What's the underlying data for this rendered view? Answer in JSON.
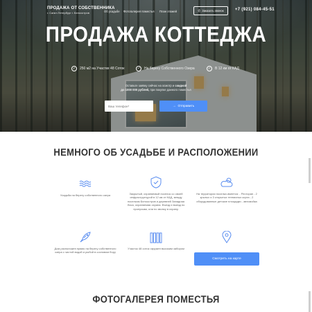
{
  "header": {
    "logo_title": "ПРОДАЖА ОТ СОБСТВЕННИКА",
    "logo_subtitle": "г. Санкт-Петербург г. Белоостров",
    "nav": [
      "Об усадьбе",
      "Фотогалерея поместья",
      "План этажей"
    ],
    "callback_label": "Заказать звонок",
    "phone": "+7 (921) 084-45-51"
  },
  "hero": {
    "title": "ПРОДАЖА КОТТЕДЖА",
    "features": [
      "250 м2 на Участке 48 Соток",
      "На берегу Собственного Озера",
      "В 12 км от КАД"
    ],
    "offer_line1": "Оставьте заявку сейчас на осмотр и",
    "offer_bold1": "скидкой",
    "offer_line2_bold": "до 1000 000 рублей,",
    "offer_line2": "при покупке данного поместья",
    "phone_placeholder": "Ваш телефон*",
    "send_label": "Отправить"
  },
  "about": {
    "title": "НЕМНОГО ОБ УСАДЬБЕ И РАСПОЛОЖЕНИИ",
    "cards": [
      {
        "icon": "waves-icon",
        "text": "Усадьба на берегу собственного озера"
      },
      {
        "icon": "shield-icon",
        "text": "Закрытый, охраняемый поселок со своей инфраструктурой в 12 км от КАД, между поселком Белоостров и деревней Западная Лиса, охраняемая охрана. Въезд и выезд по пропускам, или по звонку в охрану."
      },
      {
        "icon": "cloud-sun-icon",
        "text": "На территории поселка имеется: - Ресторан - 2 крытых и 3 открытых теннисных корта - 2 оборудованные детские площадки - автомойка"
      },
      {
        "icon": "fish-icon",
        "text": "Дом расположен прямо на берегу собственного озера с чистой водой и рыбой в сосновом бору"
      },
      {
        "icon": "fence-icon",
        "text": "Участок 48 соток окружен высоким забором"
      },
      {
        "icon": "map-pin-icon",
        "text": ""
      }
    ],
    "map_button_label": "Смотреть на карте"
  },
  "gallery": {
    "title": "ФОТОГАЛЕРЕЯ ПОМЕСТЬЯ"
  },
  "colors": {
    "accent": "#4f8ff7",
    "icon": "#5b8ef0",
    "heading": "#333333"
  }
}
